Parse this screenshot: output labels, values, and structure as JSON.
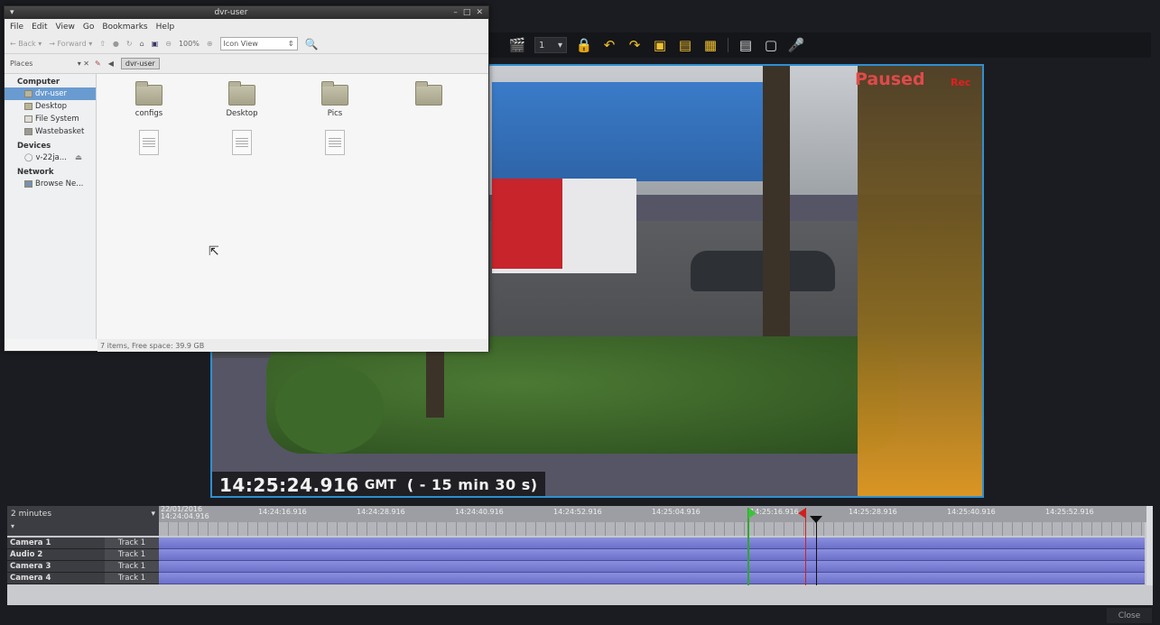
{
  "file_manager": {
    "title": "dvr-user",
    "menu": [
      "File",
      "Edit",
      "View",
      "Go",
      "Bookmarks",
      "Help"
    ],
    "toolbar": {
      "back": "Back",
      "forward": "Forward",
      "zoom": "100%",
      "view_mode": "Icon View"
    },
    "places_label": "Places",
    "breadcrumb": "dvr-user",
    "sidebar": {
      "computer_heading": "Computer",
      "computer_items": [
        "dvr-user",
        "Desktop",
        "File System",
        "Wastebasket"
      ],
      "devices_heading": "Devices",
      "devices_items": [
        "v-22ja..."
      ],
      "network_heading": "Network",
      "network_items": [
        "Browse Ne..."
      ]
    },
    "items": [
      {
        "name": "configs",
        "type": "folder"
      },
      {
        "name": "Desktop",
        "type": "folder"
      },
      {
        "name": "Pics",
        "type": "folder"
      },
      {
        "name": "",
        "type": "folder"
      },
      {
        "name": "",
        "type": "file"
      },
      {
        "name": "",
        "type": "file"
      },
      {
        "name": "",
        "type": "file"
      }
    ],
    "status": "7 items, Free space: 39.9 GB"
  },
  "toolbar": {
    "camera_count": "1"
  },
  "video": {
    "state": "Paused",
    "rec_label": "Rec",
    "time": "14:25:24.916",
    "zone": "GMT",
    "offset": "( - 15 min 30 s)"
  },
  "timeline": {
    "range": "2 minutes",
    "start_date": "22/01/2016",
    "start_time": "14:24:04.916",
    "ticks": [
      "14:24:16.916",
      "14:24:28.916",
      "14:24:40.916",
      "14:24:52.916",
      "14:25:04.916",
      "14:25:16.916",
      "14:25:28.916",
      "14:25:40.916",
      "14:25:52.916"
    ],
    "tracks": [
      {
        "name": "Camera 1",
        "label": "Track 1"
      },
      {
        "name": "Audio 2",
        "label": "Track 1"
      },
      {
        "name": "Camera 3",
        "label": "Track 1"
      },
      {
        "name": "Camera 4",
        "label": "Track 1"
      }
    ]
  },
  "close_label": "Close",
  "colors": {
    "accent": "#2f8fd0",
    "paused": "#e04a4a",
    "track": "#7b7fd8"
  }
}
